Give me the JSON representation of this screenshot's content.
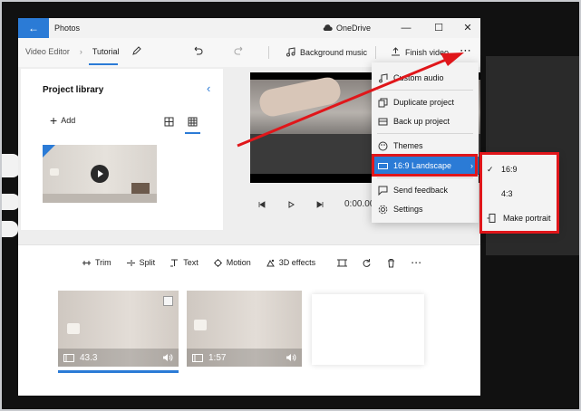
{
  "window": {
    "app_title": "Photos",
    "onedrive_label": "OneDrive",
    "back_glyph": "←",
    "minimize_glyph": "—",
    "maximize_glyph": "☐",
    "close_glyph": "✕"
  },
  "toolbar": {
    "breadcrumb_root": "Video Editor",
    "breadcrumb_current": "Tutorial",
    "background_music": "Background music",
    "finish_video": "Finish video",
    "more_glyph": "⋯"
  },
  "library": {
    "title": "Project library",
    "add_label": "Add"
  },
  "playback": {
    "time": "0:00.00"
  },
  "storyboard": {
    "tools": [
      "Trim",
      "Split",
      "Text",
      "Motion",
      "3D effects"
    ],
    "clips": [
      {
        "duration": "43.3"
      },
      {
        "duration": "1:57"
      }
    ]
  },
  "menu": {
    "items": [
      {
        "label": "Custom audio",
        "icon": "music-icon"
      },
      {
        "label": "Duplicate project",
        "icon": "duplicate-icon"
      },
      {
        "label": "Back up project",
        "icon": "backup-icon"
      },
      {
        "label": "Themes",
        "icon": "palette-icon"
      },
      {
        "label": "16:9 Landscape",
        "icon": "aspect-ratio-icon"
      },
      {
        "label": "Send feedback",
        "icon": "feedback-icon"
      },
      {
        "label": "Settings",
        "icon": "gear-icon"
      }
    ]
  },
  "submenu": {
    "checked": "✓",
    "items": [
      "16:9",
      "4:3"
    ],
    "make_portrait": "Make portrait"
  },
  "colors": {
    "accent": "#2b7bd6",
    "annotation_red": "#e0161a",
    "menu_bg": "#f3f3f3"
  }
}
